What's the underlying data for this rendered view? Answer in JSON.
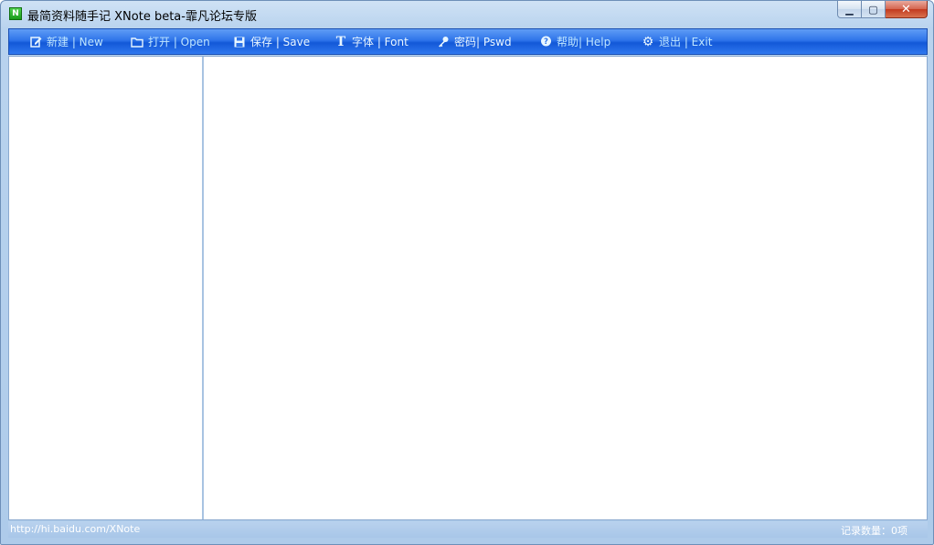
{
  "window": {
    "title": "最简资料随手记 XNote beta-霏凡论坛专版",
    "icon": "xnote-app-icon",
    "controls": {
      "minimize": "▁",
      "maximize": "▢",
      "close": "✕"
    }
  },
  "toolbar": {
    "items": [
      {
        "label": "新建 | New",
        "icon": "edit-icon"
      },
      {
        "label": "打开 | Open",
        "icon": "folder-icon"
      },
      {
        "label": "保存 | Save",
        "icon": "floppy-disk-icon"
      },
      {
        "label": "字体 | Font",
        "icon": "font-t-icon"
      },
      {
        "label": "密码| Pswd",
        "icon": "key-icon"
      },
      {
        "label": "帮助| Help",
        "icon": "help-bubble-icon"
      },
      {
        "label": "退出 | Exit",
        "icon": "gear-icon"
      }
    ]
  },
  "statusbar": {
    "url": "http://hi.baidu.com/XNote",
    "record_count": "记录数量：0项"
  },
  "colors": {
    "toolbar_top": "#5f9cf5",
    "toolbar_bottom": "#1358d8",
    "frame": "#b9d3ee",
    "status_text": "#ffffff"
  }
}
